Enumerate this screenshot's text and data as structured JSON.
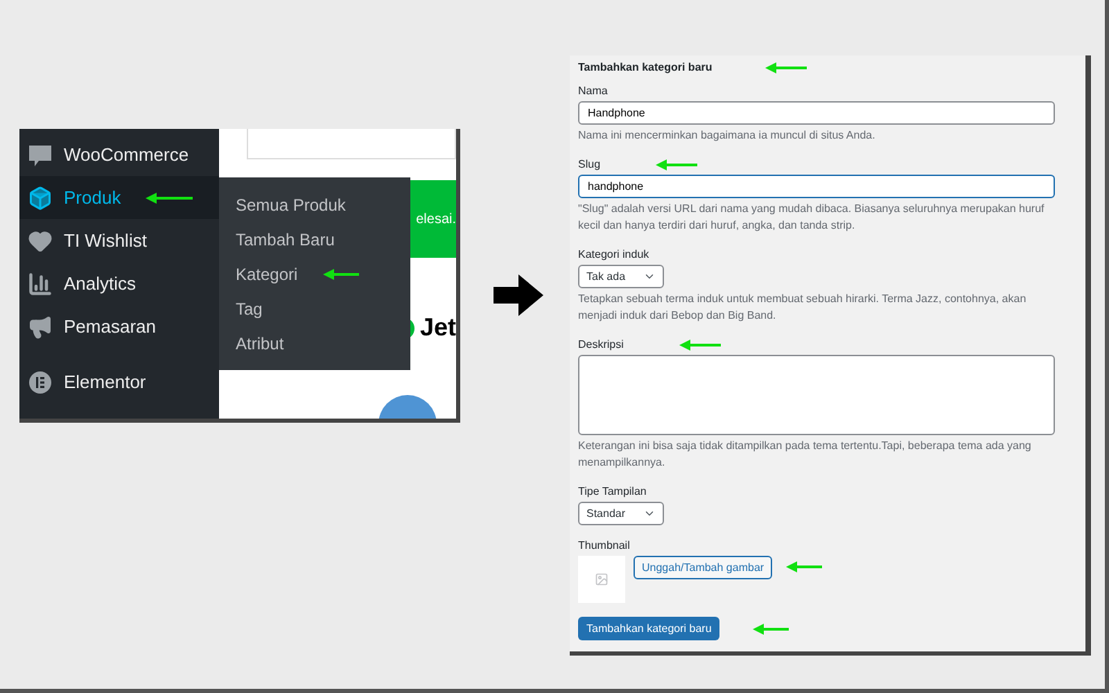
{
  "admin_menu": {
    "items": [
      {
        "label": "WooCommerce",
        "selected": false,
        "marked": false
      },
      {
        "label": "Produk",
        "selected": true,
        "marked": true
      },
      {
        "label": "TI Wishlist",
        "selected": false,
        "marked": false
      },
      {
        "label": "Analytics",
        "selected": false,
        "marked": false
      },
      {
        "label": "Pemasaran",
        "selected": false,
        "marked": false
      }
    ],
    "lower_items": [
      {
        "label": "Elementor",
        "selected": false,
        "marked": false
      }
    ]
  },
  "submenu": {
    "items": [
      {
        "label": "Semua Produk",
        "marked": false
      },
      {
        "label": "Tambah Baru",
        "marked": false
      },
      {
        "label": "Kategori",
        "marked": true
      },
      {
        "label": "Tag",
        "marked": false
      },
      {
        "label": "Atribut",
        "marked": false
      }
    ]
  },
  "page_fragment": {
    "notice": "elesai.",
    "heading": "Jet"
  },
  "form": {
    "title": "Tambahkan kategori baru",
    "title_marked": true,
    "fields": [
      {
        "kind": "text",
        "label": "Nama",
        "value": "Handphone",
        "focused": false,
        "hint": "Nama ini mencerminkan bagaimana ia muncul di situs Anda.",
        "marked": false
      },
      {
        "kind": "text",
        "label": "Slug",
        "value": "handphone",
        "focused": true,
        "hint": "\"Slug\" adalah versi URL dari nama yang mudah dibaca. Biasanya seluruhnya merupakan huruf kecil dan hanya terdiri dari huruf, angka, dan tanda strip.",
        "marked": true
      },
      {
        "kind": "select",
        "label": "Kategori induk",
        "value": "Tak ada",
        "hint": "Tetapkan sebuah terma induk untuk membuat sebuah hirarki. Terma Jazz, contohnya, akan menjadi induk dari Bebop dan Big Band.",
        "marked": false
      },
      {
        "kind": "textarea",
        "label": "Deskripsi",
        "hint": "Keterangan ini bisa saja tidak ditampilkan pada tema tertentu.Tapi, beberapa tema ada yang menampilkannya.",
        "marked": true
      },
      {
        "kind": "select",
        "label": "Tipe Tampilan",
        "value": "Standar",
        "marked": false
      },
      {
        "kind": "thumbnail",
        "label": "Thumbnail",
        "button": "Unggah/Tambah gambar",
        "marked": true
      }
    ],
    "submit": {
      "label": "Tambahkan kategori baru",
      "marked": true
    }
  }
}
